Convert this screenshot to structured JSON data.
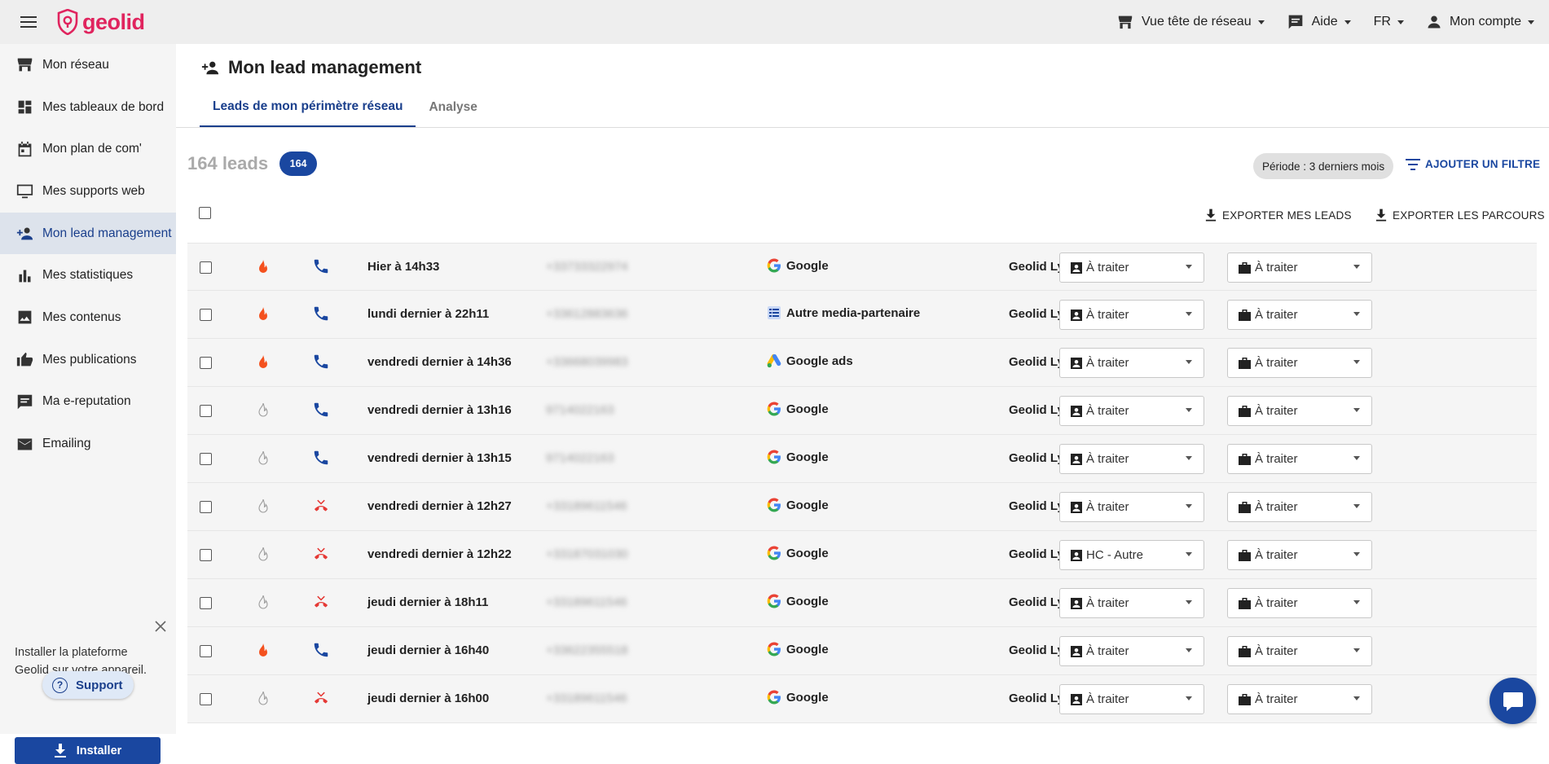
{
  "header": {
    "logo_text": "geolid",
    "network_view": "Vue tête de réseau",
    "help": "Aide",
    "lang": "FR",
    "account": "Mon compte"
  },
  "sidebar": {
    "items": [
      {
        "label": "Mon réseau",
        "icon": "store-icon"
      },
      {
        "label": "Mes tableaux de bord",
        "icon": "dashboard-icon"
      },
      {
        "label": "Mon plan de com'",
        "icon": "calendar-icon"
      },
      {
        "label": "Mes supports web",
        "icon": "monitor-icon"
      },
      {
        "label": "Mon lead management",
        "icon": "person-add-icon",
        "active": true
      },
      {
        "label": "Mes statistiques",
        "icon": "bar-chart-icon"
      },
      {
        "label": "Mes contenus",
        "icon": "image-icon"
      },
      {
        "label": "Mes publications",
        "icon": "thumb-up-icon"
      },
      {
        "label": "Ma e-reputation",
        "icon": "comment-icon"
      },
      {
        "label": "Emailing",
        "icon": "mail-icon"
      }
    ],
    "install_text": "Installer la plateforme Geolid sur votre appareil.",
    "support_label": "Support",
    "install_button": "Installer"
  },
  "main": {
    "title": "Mon lead management",
    "tabs": [
      {
        "label": "Leads de mon périmètre réseau",
        "active": true
      },
      {
        "label": "Analyse",
        "active": false
      }
    ],
    "lead_count_text": "164 leads",
    "lead_badge": "164",
    "period_chip": "Période : 3 derniers mois",
    "add_filter": "AJOUTER UN FILTRE",
    "export_leads": "EXPORTER MES LEADS",
    "export_paths": "EXPORTER LES PARCOURS"
  },
  "colors": {
    "brand": "#e0245e",
    "accent": "#1a47a0",
    "flame_hot": "#f4511e",
    "flame_cold": "#9e9e9e",
    "call_ok": "#1a47a0",
    "call_missed": "#e53935"
  },
  "leads": [
    {
      "hot": true,
      "call": "answered",
      "date": "Hier à 14h33",
      "number": "+33733322974",
      "source": "Google",
      "source_icon": "google-icon",
      "agency": "Geolid Lyon",
      "status1": "À traiter",
      "status2": "À traiter"
    },
    {
      "hot": true,
      "call": "answered",
      "date": "lundi dernier à 22h11",
      "number": "+33612883636",
      "source": "Autre media-partenaire",
      "source_icon": "partner-media-icon",
      "agency": "Geolid Lyon",
      "status1": "À traiter",
      "status2": "À traiter"
    },
    {
      "hot": true,
      "call": "answered",
      "date": "vendredi dernier à 14h36",
      "number": "+33668039983",
      "source": "Google ads",
      "source_icon": "google-ads-icon",
      "agency": "Geolid Lyon",
      "status1": "À traiter",
      "status2": "À traiter"
    },
    {
      "hot": false,
      "call": "answered",
      "date": "vendredi dernier à 13h16",
      "number": "9714022163",
      "source": "Google",
      "source_icon": "google-icon",
      "agency": "Geolid Lyon",
      "status1": "À traiter",
      "status2": "À traiter"
    },
    {
      "hot": false,
      "call": "answered",
      "date": "vendredi dernier à 13h15",
      "number": "9714022163",
      "source": "Google",
      "source_icon": "google-icon",
      "agency": "Geolid Lyon",
      "status1": "À traiter",
      "status2": "À traiter"
    },
    {
      "hot": false,
      "call": "missed",
      "date": "vendredi dernier à 12h27",
      "number": "+33189611546",
      "source": "Google",
      "source_icon": "google-icon",
      "agency": "Geolid Lyon",
      "status1": "À traiter",
      "status2": "À traiter"
    },
    {
      "hot": false,
      "call": "missed",
      "date": "vendredi dernier à 12h22",
      "number": "+33187031030",
      "source": "Google",
      "source_icon": "google-icon",
      "agency": "Geolid Lyon",
      "status1": "HC - Autre",
      "status2": "À traiter"
    },
    {
      "hot": false,
      "call": "missed",
      "date": "jeudi dernier à 18h11",
      "number": "+33189611546",
      "source": "Google",
      "source_icon": "google-icon",
      "agency": "Geolid Lyon",
      "status1": "À traiter",
      "status2": "À traiter"
    },
    {
      "hot": true,
      "call": "answered",
      "date": "jeudi dernier à 16h40",
      "number": "+33622355518",
      "source": "Google",
      "source_icon": "google-icon",
      "agency": "Geolid Lyon",
      "status1": "À traiter",
      "status2": "À traiter"
    },
    {
      "hot": false,
      "call": "missed",
      "date": "jeudi dernier à 16h00",
      "number": "+33189611546",
      "source": "Google",
      "source_icon": "google-icon",
      "agency": "Geolid Lyon",
      "status1": "À traiter",
      "status2": "À traiter"
    }
  ]
}
